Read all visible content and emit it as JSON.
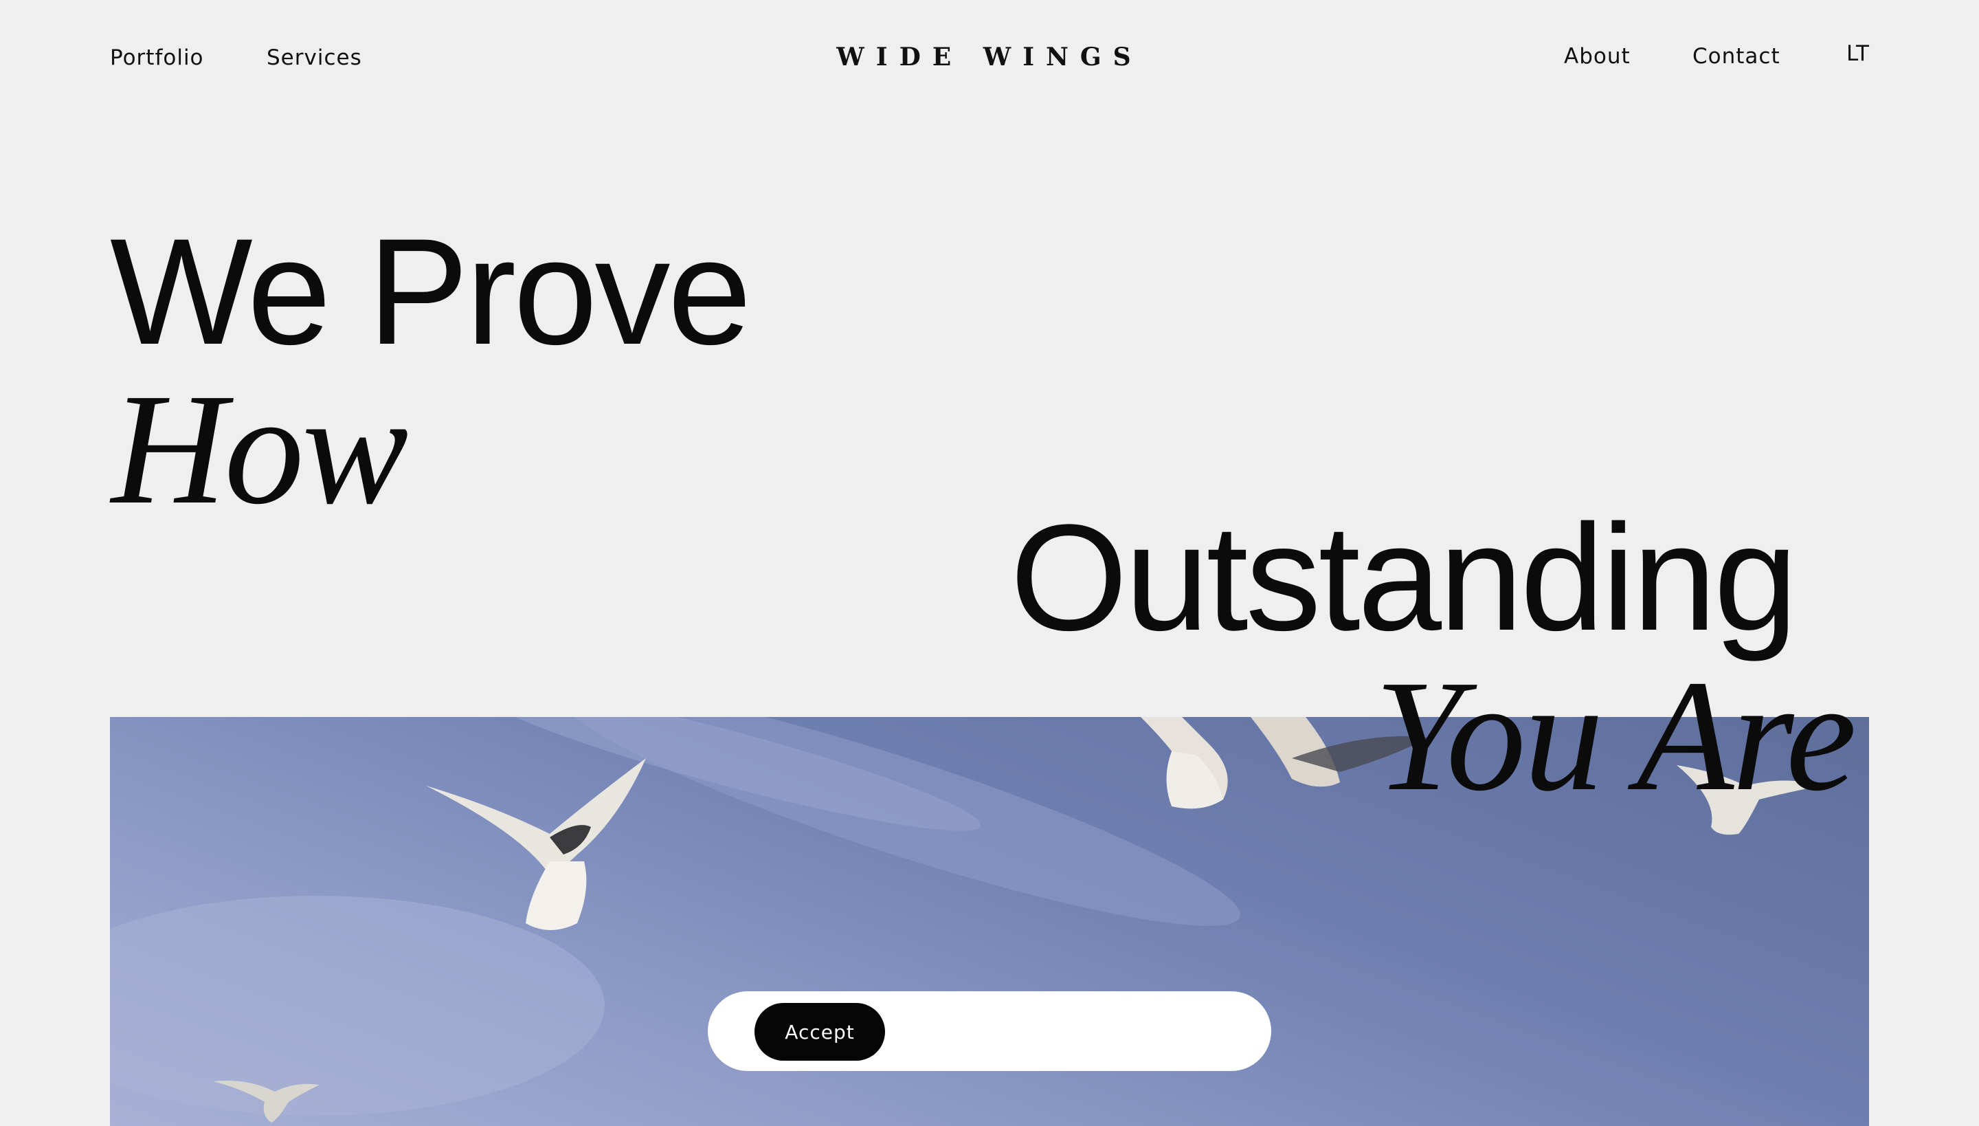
{
  "nav": {
    "left": [
      "Portfolio",
      "Services"
    ],
    "logo": "WIDE WINGS",
    "right": [
      "About",
      "Contact"
    ],
    "language": "LT"
  },
  "hero": {
    "line1": "We Prove",
    "line2": "How",
    "line3": "Outstanding",
    "line4": "You Are"
  },
  "cookie": {
    "accept_label": "Accept"
  },
  "colors": {
    "background": "#efefef",
    "text": "#0b0b0b",
    "sky": "#6d7eb0"
  }
}
